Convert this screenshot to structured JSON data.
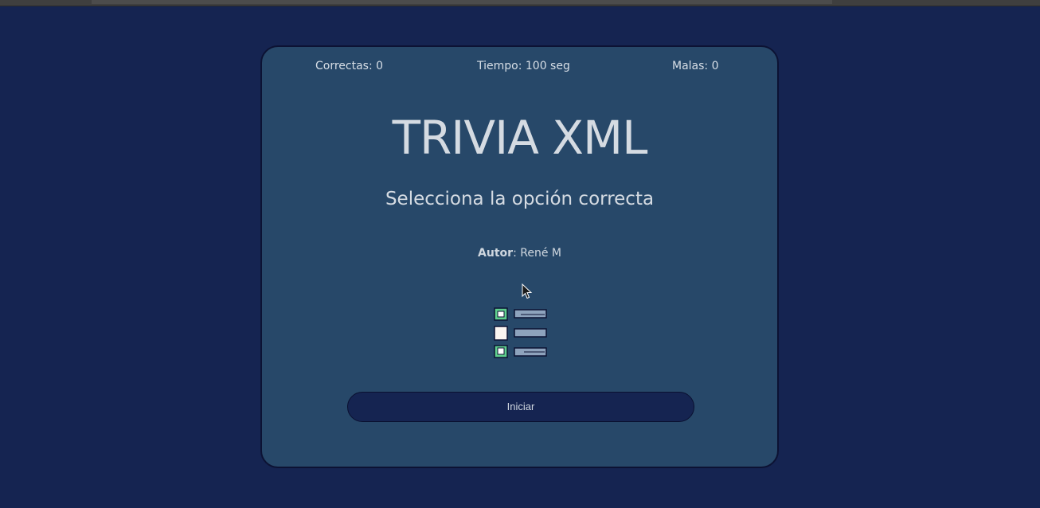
{
  "stats": {
    "correct": "Correctas: 0",
    "time": "Tiempo: 100 seg",
    "wrong": "Malas: 0"
  },
  "title": "TRIVIA XML",
  "subtitle": "Selecciona la opción correcta",
  "author": {
    "label": "Autor",
    "separator": ":",
    "name": "René M"
  },
  "start_button": "Iniciar",
  "icons": [
    "quiz-checklist-icon",
    "mouse-cursor-icon"
  ],
  "colors": {
    "page_background": "#152451",
    "card_background": "#274869",
    "button_background": "#152451",
    "text": "#d5dbe2",
    "checkbox_green": "#5fcf8d"
  }
}
